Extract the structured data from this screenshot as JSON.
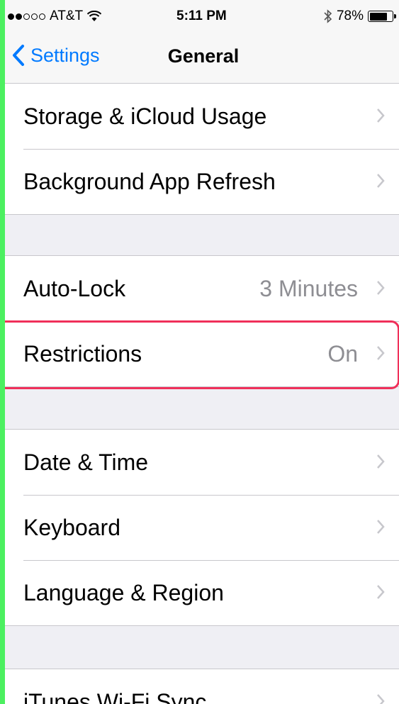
{
  "status_bar": {
    "carrier": "AT&T",
    "time": "5:11 PM",
    "battery_percent": "78%",
    "battery_level": 0.78,
    "signal_strength": 2
  },
  "nav": {
    "back_label": "Settings",
    "title": "General"
  },
  "groups": [
    {
      "rows": [
        {
          "label": "Storage & iCloud Usage",
          "value": ""
        },
        {
          "label": "Background App Refresh",
          "value": ""
        }
      ]
    },
    {
      "rows": [
        {
          "label": "Auto-Lock",
          "value": "3 Minutes"
        },
        {
          "label": "Restrictions",
          "value": "On"
        }
      ]
    },
    {
      "rows": [
        {
          "label": "Date & Time",
          "value": ""
        },
        {
          "label": "Keyboard",
          "value": ""
        },
        {
          "label": "Language & Region",
          "value": ""
        }
      ]
    },
    {
      "rows": [
        {
          "label": "iTunes Wi-Fi Sync",
          "value": ""
        }
      ]
    }
  ],
  "colors": {
    "accent": "#007aff",
    "highlight": "#f0305a",
    "border_frame": "#4cf060"
  }
}
